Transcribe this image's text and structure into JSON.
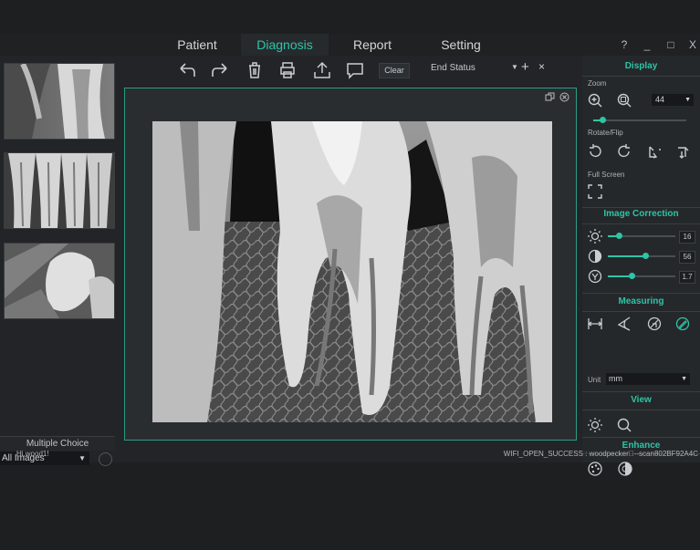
{
  "nav": {
    "tabs": [
      {
        "label": "Patient"
      },
      {
        "label": "Diagnosis"
      },
      {
        "label": "Report"
      },
      {
        "label": "Setting"
      }
    ],
    "help": "?",
    "minimize": "_",
    "maximize": "□",
    "close": "X"
  },
  "thumbnails": {
    "items": [
      {
        "icon": "xray-thumb-molar"
      },
      {
        "icon": "xray-thumb-incisors"
      },
      {
        "icon": "xray-thumb-wisdom"
      }
    ],
    "multiple_choice": "Multiple Choice",
    "filter": "All Images"
  },
  "toolbar": {
    "clear": "Clear",
    "end_status": "End Status",
    "plus": "+",
    "close": "×"
  },
  "panel": {
    "display": "Display",
    "zoom_label": "Zoom",
    "zoom_value": "44",
    "rotate_label": "Rotate/Flip",
    "fullscreen_label": "Full Screen",
    "image_correction": "Image Correction",
    "brightness": "16",
    "contrast": "56",
    "gamma": "1.7",
    "measuring": "Measuring",
    "unit_label": "Unit",
    "unit_value": "mm",
    "view": "View",
    "enhance": "Enhance",
    "slider_levels": {
      "zoom": 0.1,
      "brightness": 0.16,
      "contrast": 0.56,
      "gamma": 0.35
    }
  },
  "status": {
    "left": "Hi,wood1!",
    "right": "WIFI_OPEN_SUCCESS : woodpecker\u0000--scan802BF92A4C"
  },
  "colors": {
    "accent": "#2ec4a6",
    "background": "#222427"
  }
}
